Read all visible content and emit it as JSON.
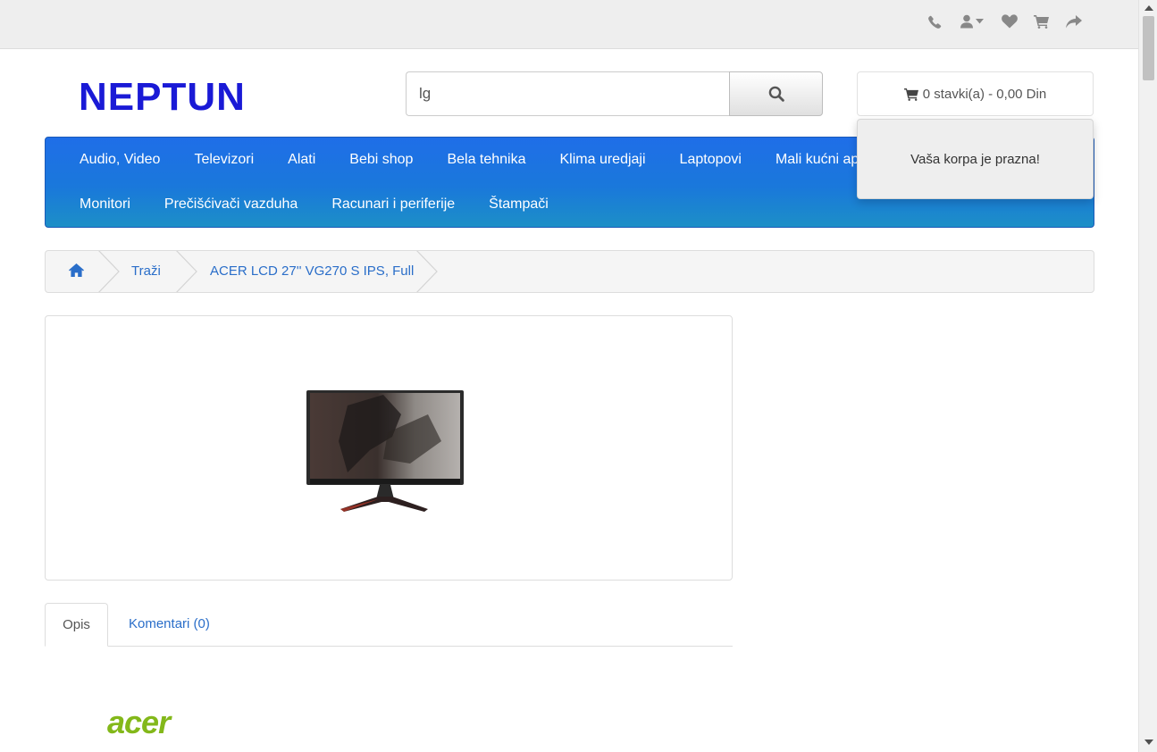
{
  "topbar": {
    "icons": [
      "phone-icon",
      "user-icon",
      "heart-icon",
      "cart-icon",
      "share-icon"
    ]
  },
  "header": {
    "logo_text": "NEPTUN",
    "search": {
      "value": "lg"
    },
    "cart": {
      "label": "0 stavki(a) - 0,00 Din",
      "empty_message": "Vaša korpa je prazna!"
    }
  },
  "menu": {
    "row1": [
      "Audio, Video",
      "Televizori",
      "Alati",
      "Bebi shop",
      "Bela tehnika",
      "Klima uredjaji",
      "Laptopovi",
      "Mali kućni apar"
    ],
    "row2": [
      "Monitori",
      "Prečišćivači vazduha",
      "Racunari i periferije",
      "Štampači"
    ]
  },
  "breadcrumb": {
    "items": [
      "Traži",
      "ACER LCD 27'' VG270 S IPS, Full"
    ]
  },
  "tabs": [
    "Opis",
    "Komentari (0)"
  ],
  "brand": {
    "logo_text": "acer"
  },
  "colors": {
    "logo": "#1a1ad6",
    "menu_top": "#1f6ee8",
    "menu_bottom": "#1c8fc7",
    "link": "#2a6ec9",
    "acer_green": "#83b81a"
  }
}
